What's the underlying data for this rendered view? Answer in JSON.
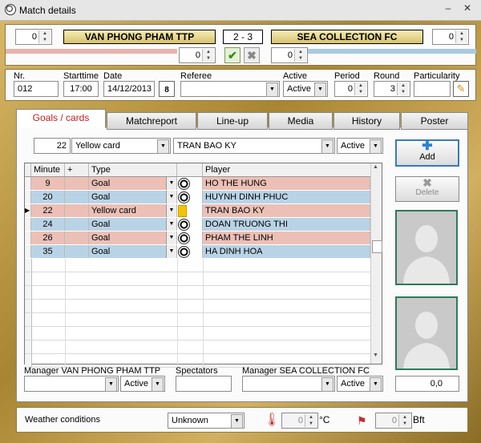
{
  "window": {
    "title": "Match details",
    "minimize": "–",
    "close": "✕"
  },
  "score": {
    "home_value_left": "0",
    "home_team": "VAN PHONG PHAM TTP",
    "score_text": "2 - 3",
    "away_team": "SEA COLLECTION FC",
    "away_value_right": "0",
    "home_value_mid": "0",
    "away_value_mid": "0"
  },
  "info": {
    "nr_label": "Nr.",
    "nr": "012",
    "starttime_label": "Starttime",
    "starttime": "17:00",
    "date_label": "Date",
    "date": "14/12/2013",
    "calendar_num": "8",
    "referee_label": "Referee",
    "referee": "",
    "active_label": "Active",
    "active": "Active",
    "period_label": "Period",
    "period": "0",
    "round_label": "Round",
    "round": "3",
    "particularity_label": "Particularity"
  },
  "tabs": [
    "Goals / cards",
    "Matchreport",
    "Line-up",
    "Media",
    "History",
    "Poster"
  ],
  "entry": {
    "minute": "22",
    "type": "Yellow card",
    "player": "TRAN BAO KY",
    "status": "Active"
  },
  "table": {
    "headers": {
      "minute": "Minute",
      "plus": "+",
      "type": "Type",
      "player": "Player"
    },
    "rows": [
      {
        "minute": "9",
        "type": "Goal",
        "player": "HO THE HUNG",
        "icon": "ball",
        "color": "#ecc0b6"
      },
      {
        "minute": "20",
        "type": "Goal",
        "player": "HUYNH DINH PHUC",
        "icon": "ball",
        "color": "#b9d3e6"
      },
      {
        "minute": "22",
        "type": "Yellow card",
        "player": "TRAN BAO KY",
        "icon": "card",
        "color": "#ecc0b6"
      },
      {
        "minute": "24",
        "type": "Goal",
        "player": "DOAN TRUONG THI",
        "icon": "ball",
        "color": "#b9d3e6"
      },
      {
        "minute": "26",
        "type": "Goal",
        "player": "PHAM THE LINH",
        "icon": "ball",
        "color": "#ecc0b6"
      },
      {
        "minute": "35",
        "type": "Goal",
        "player": "HA DINH HOA",
        "icon": "ball",
        "color": "#b9d3e6"
      }
    ]
  },
  "buttons": {
    "add": "Add",
    "delete": "Delete"
  },
  "bottom": {
    "manager_home_label": "Manager VAN PHONG PHAM TTP",
    "manager_home_status": "Active",
    "spectators_label": "Spectators",
    "manager_away_label": "Manager SEA COLLECTION FC",
    "manager_away_status": "Active",
    "amount": "0,0"
  },
  "weather": {
    "label": "Weather conditions",
    "condition": "Unknown",
    "temp": "0",
    "temp_unit": "°C",
    "wind": "0",
    "wind_unit": "Bft"
  },
  "colors": {
    "frame": "#c8a24e",
    "team_bar": "#e8d88a",
    "row_pink": "#ecc0b6",
    "row_blue": "#b9d3e6",
    "active_tab_text": "#c02020"
  }
}
